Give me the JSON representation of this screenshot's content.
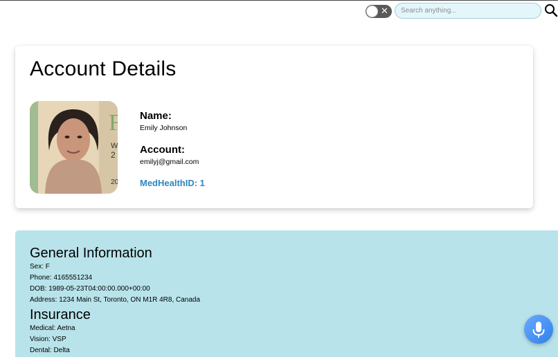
{
  "topbar": {
    "search_placeholder": "Search anything..."
  },
  "account": {
    "title": "Account Details",
    "name_label": "Name:",
    "name_value": "Emily Johnson",
    "account_label": "Account:",
    "account_value": "emilyj@gmail.com",
    "medhealth_id": "MedHealthID: 1"
  },
  "general": {
    "title": "General Information",
    "sex": "Sex: F",
    "phone": "Phone: 4165551234",
    "dob": "DOB: 1989-05-23T04:00:00.000+00:00",
    "address": "Address: 1234 Main St, Toronto, ON M1R 4R8, Canada"
  },
  "insurance": {
    "title": "Insurance",
    "medical": "Medical: Aetna",
    "vision": "Vision: VSP",
    "dental": "Dental: Delta"
  },
  "colors": {
    "accent_blue": "#2f86c0",
    "section_bg": "#b8e3ea",
    "search_bg": "#e3f7fa",
    "mic_button": "#4a90f0"
  },
  "icons": {
    "toggle": "toggle-x-icon",
    "search": "search-icon",
    "mic": "microphone-icon"
  }
}
